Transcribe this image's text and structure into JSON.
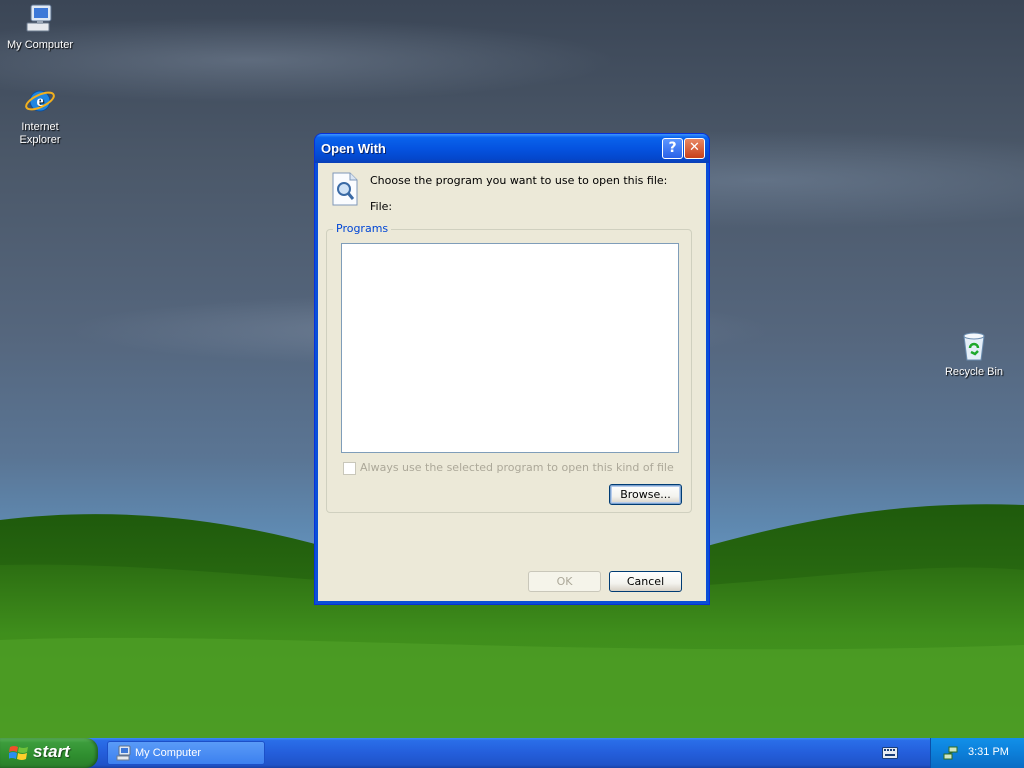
{
  "desktop": {
    "icons": [
      {
        "label": "My Computer",
        "icon": "my-computer-icon"
      },
      {
        "label": "Internet Explorer",
        "icon": "internet-explorer-icon"
      },
      {
        "label": "Recycle Bin",
        "icon": "recycle-bin-icon"
      }
    ]
  },
  "dialog": {
    "title": "Open With",
    "prompt": "Choose the program you want to use to open this file:",
    "file_label": "File:",
    "programs_group": "Programs",
    "programs": [],
    "always_use_label": "Always use the selected program to open this kind of file",
    "always_use_checked": false,
    "browse_label": "Browse...",
    "ok_label": "OK",
    "cancel_label": "Cancel",
    "help_glyph": "?",
    "close_glyph": "✕"
  },
  "taskbar": {
    "start_label": "start",
    "items": [
      {
        "label": "My Computer",
        "icon": "my-computer-icon"
      }
    ],
    "clock": "3:31 PM"
  },
  "colors": {
    "title_bar": "#0553e0",
    "group_title": "#0046d5",
    "start_button": "#3c9c3c"
  }
}
